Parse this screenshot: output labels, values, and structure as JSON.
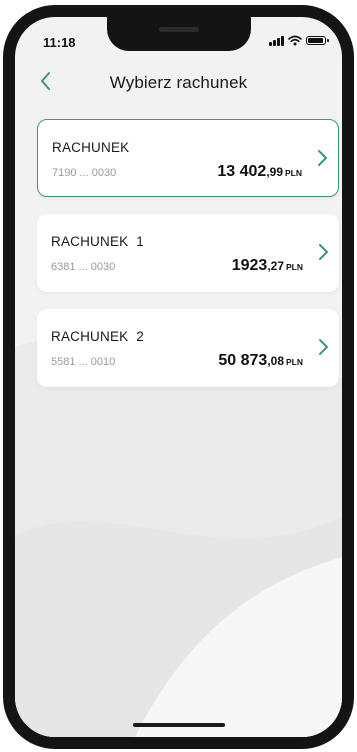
{
  "status_bar": {
    "time": "11:18",
    "icons": [
      "signal-icon",
      "wifi-icon",
      "battery-icon"
    ]
  },
  "header": {
    "title": "Wybierz rachunek",
    "back_icon": "chevron-left-icon"
  },
  "accounts": [
    {
      "name": "RACHUNEK",
      "number": "7190 ... 0030",
      "amount_int": "13 402",
      "amount_dec": ",99",
      "currency": "PLN",
      "selected": true
    },
    {
      "name": "RACHUNEK  1",
      "number": "6381 ... 0030",
      "amount_int": "1923",
      "amount_dec": ",27",
      "currency": "PLN",
      "selected": false
    },
    {
      "name": "RACHUNEK  2",
      "number": "5581 ... 0010",
      "amount_int": "50 873",
      "amount_dec": ",08",
      "currency": "PLN",
      "selected": false
    }
  ],
  "colors": {
    "accent": "#3e9a6e",
    "background": "#f2f2f2",
    "card": "#ffffff"
  }
}
